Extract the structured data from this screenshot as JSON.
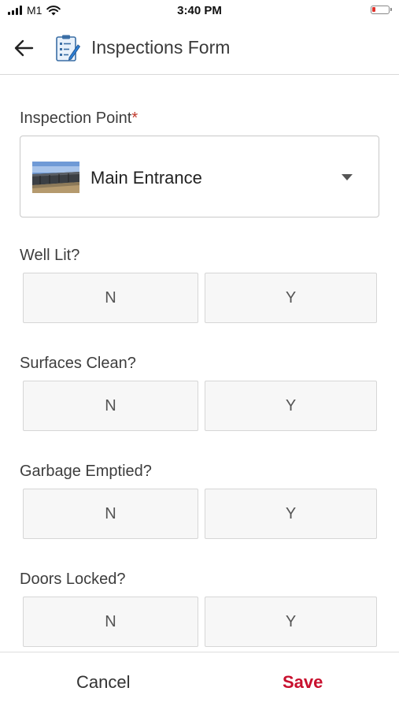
{
  "status_bar": {
    "carrier": "M1",
    "time": "3:40 PM",
    "icons": [
      "signal-icon",
      "wifi-icon",
      "battery-low-icon"
    ]
  },
  "header": {
    "title": "Inspections Form",
    "back_icon": "arrow-left-icon",
    "form_icon": "clipboard-checklist-icon"
  },
  "form": {
    "inspection_point": {
      "label": "Inspection Point",
      "required_mark": "*",
      "selected": "Main Entrance",
      "dropdown_icon": "caret-down-icon"
    },
    "questions": [
      {
        "label": "Well Lit?",
        "no": "N",
        "yes": "Y"
      },
      {
        "label": "Surfaces Clean?",
        "no": "N",
        "yes": "Y"
      },
      {
        "label": "Garbage Emptied?",
        "no": "N",
        "yes": "Y"
      },
      {
        "label": "Doors Locked?",
        "no": "N",
        "yes": "Y"
      }
    ]
  },
  "footer": {
    "cancel_label": "Cancel",
    "save_label": "Save"
  },
  "colors": {
    "accent_save": "#c8102e",
    "required": "#c0392b",
    "battery_low": "#e0332c"
  }
}
